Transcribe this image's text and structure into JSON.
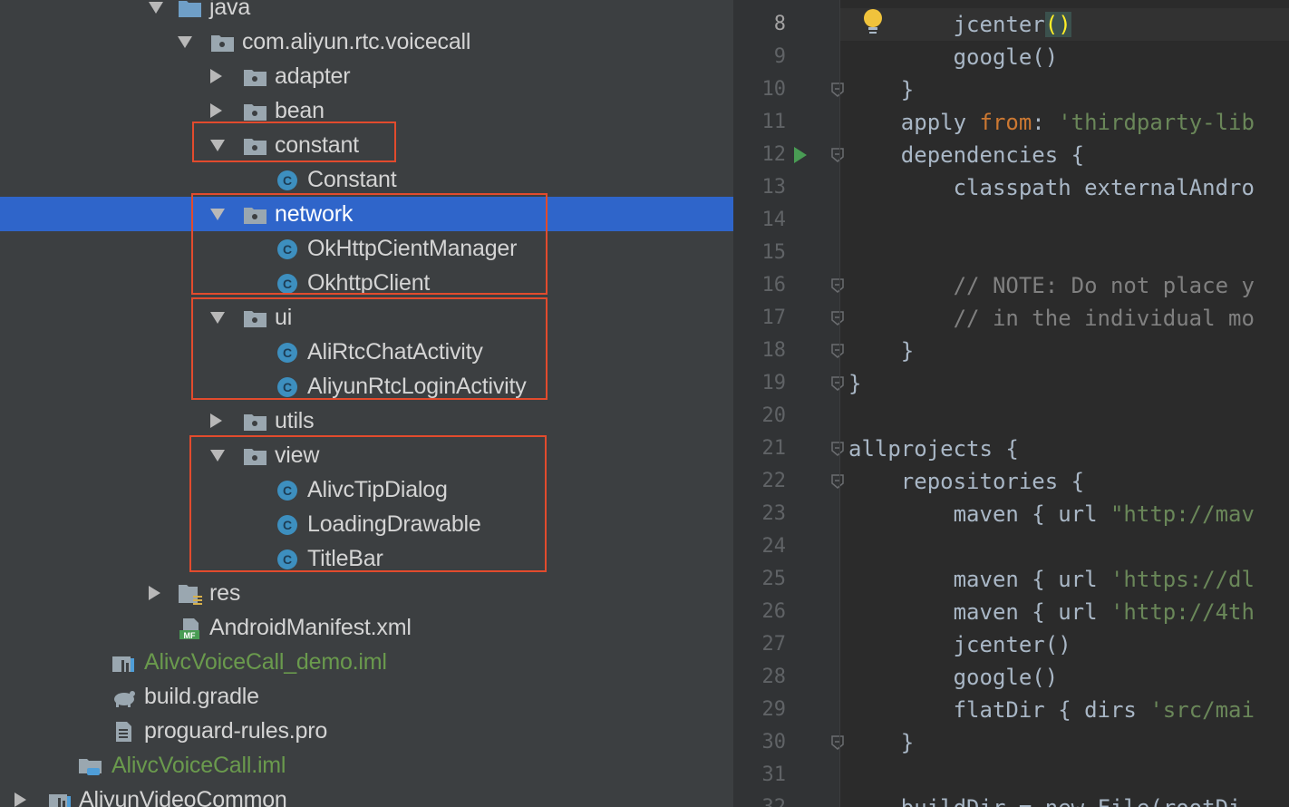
{
  "tree": {
    "rows": [
      {
        "label": "java",
        "indent": 2,
        "kind": "folder-blue",
        "arrow": "down"
      },
      {
        "label": "com.aliyun.rtc.voicecall",
        "indent": 3,
        "kind": "package",
        "arrow": "down"
      },
      {
        "label": "adapter",
        "indent": 4,
        "kind": "package",
        "arrow": "right"
      },
      {
        "label": "bean",
        "indent": 4,
        "kind": "package",
        "arrow": "right"
      },
      {
        "label": "constant",
        "indent": 4,
        "kind": "package",
        "arrow": "down"
      },
      {
        "label": "Constant",
        "indent": 5,
        "kind": "class",
        "arrow": "none"
      },
      {
        "label": "network",
        "indent": 4,
        "kind": "package",
        "arrow": "down",
        "selected": true
      },
      {
        "label": "OkHttpCientManager",
        "indent": 5,
        "kind": "class",
        "arrow": "none"
      },
      {
        "label": "OkhttpClient",
        "indent": 5,
        "kind": "class",
        "arrow": "none"
      },
      {
        "label": "ui",
        "indent": 4,
        "kind": "package",
        "arrow": "down"
      },
      {
        "label": "AliRtcChatActivity",
        "indent": 5,
        "kind": "class",
        "arrow": "none"
      },
      {
        "label": "AliyunRtcLoginActivity",
        "indent": 5,
        "kind": "class",
        "arrow": "none"
      },
      {
        "label": "utils",
        "indent": 4,
        "kind": "package",
        "arrow": "right"
      },
      {
        "label": "view",
        "indent": 4,
        "kind": "package",
        "arrow": "down"
      },
      {
        "label": "AlivcTipDialog",
        "indent": 5,
        "kind": "class",
        "arrow": "none"
      },
      {
        "label": "LoadingDrawable",
        "indent": 5,
        "kind": "class",
        "arrow": "none"
      },
      {
        "label": "TitleBar",
        "indent": 5,
        "kind": "class",
        "arrow": "none"
      },
      {
        "label": "res",
        "indent": 2,
        "kind": "res-folder",
        "arrow": "right"
      },
      {
        "label": "AndroidManifest.xml",
        "indent": 2,
        "kind": "manifest",
        "arrow": "none"
      },
      {
        "label": "AlivcVoiceCall_demo.iml",
        "indent": 0,
        "kind": "iml",
        "arrow": "none",
        "green": true
      },
      {
        "label": "build.gradle",
        "indent": 0,
        "kind": "gradle",
        "arrow": "none"
      },
      {
        "label": "proguard-rules.pro",
        "indent": 0,
        "kind": "file",
        "arrow": "none"
      },
      {
        "label": "AlivcVoiceCall.iml",
        "indent": -1,
        "kind": "module-iml",
        "arrow": "none",
        "green": true
      },
      {
        "label": "AliyunVideoCommon",
        "indent": -2,
        "kind": "module",
        "arrow": "right"
      }
    ]
  },
  "editor": {
    "current_line": 8,
    "lines": [
      {
        "n": "8",
        "tokens": [
          {
            "t": "        jcenter",
            "c": "fn"
          },
          {
            "t": "()",
            "c": "fn"
          }
        ],
        "bulb": true
      },
      {
        "n": "9",
        "tokens": [
          {
            "t": "        google()",
            "c": "fn"
          }
        ]
      },
      {
        "n": "10",
        "tokens": [
          {
            "t": "    }",
            "c": "fn"
          }
        ],
        "fold": true
      },
      {
        "n": "11",
        "tokens": [
          {
            "t": "    apply ",
            "c": "fn"
          },
          {
            "t": "from",
            "c": "kw"
          },
          {
            "t": ": ",
            "c": "fn"
          },
          {
            "t": "'thirdparty-lib",
            "c": "str"
          }
        ]
      },
      {
        "n": "12",
        "tokens": [
          {
            "t": "    dependencies {",
            "c": "fn"
          }
        ],
        "fold": true,
        "run": true
      },
      {
        "n": "13",
        "tokens": [
          {
            "t": "        classpath externalAndro",
            "c": "fn"
          }
        ]
      },
      {
        "n": "14",
        "tokens": []
      },
      {
        "n": "15",
        "tokens": []
      },
      {
        "n": "16",
        "tokens": [
          {
            "t": "        // NOTE: Do not place y",
            "c": "cm"
          }
        ],
        "fold": true
      },
      {
        "n": "17",
        "tokens": [
          {
            "t": "        // in the individual mo",
            "c": "cm"
          }
        ],
        "fold": true
      },
      {
        "n": "18",
        "tokens": [
          {
            "t": "    }",
            "c": "fn"
          }
        ],
        "fold": true
      },
      {
        "n": "19",
        "tokens": [
          {
            "t": "}",
            "c": "fn"
          }
        ],
        "fold": true
      },
      {
        "n": "20",
        "tokens": []
      },
      {
        "n": "21",
        "tokens": [
          {
            "t": "allprojects {",
            "c": "fn"
          }
        ],
        "fold": true
      },
      {
        "n": "22",
        "tokens": [
          {
            "t": "    repositories {",
            "c": "fn"
          }
        ],
        "fold": true
      },
      {
        "n": "23",
        "tokens": [
          {
            "t": "        maven { url ",
            "c": "fn"
          },
          {
            "t": "\"http://mav",
            "c": "str"
          }
        ]
      },
      {
        "n": "24",
        "tokens": []
      },
      {
        "n": "25",
        "tokens": [
          {
            "t": "        maven { url ",
            "c": "fn"
          },
          {
            "t": "'https://dl",
            "c": "str"
          }
        ]
      },
      {
        "n": "26",
        "tokens": [
          {
            "t": "        maven { url ",
            "c": "fn"
          },
          {
            "t": "'http://4th",
            "c": "str"
          }
        ]
      },
      {
        "n": "27",
        "tokens": [
          {
            "t": "        jcenter()",
            "c": "fn"
          }
        ]
      },
      {
        "n": "28",
        "tokens": [
          {
            "t": "        google()",
            "c": "fn"
          }
        ]
      },
      {
        "n": "29",
        "tokens": [
          {
            "t": "        flatDir { dirs ",
            "c": "fn"
          },
          {
            "t": "'src/mai",
            "c": "str"
          }
        ]
      },
      {
        "n": "30",
        "tokens": [
          {
            "t": "    }",
            "c": "fn"
          }
        ],
        "fold": true
      },
      {
        "n": "31",
        "tokens": []
      },
      {
        "n": "32",
        "tokens": [
          {
            "t": "    buildDir = new File(rootDi",
            "c": "fn"
          }
        ]
      }
    ]
  },
  "colors": {
    "selection": "#2f65ca",
    "annotation_box": "#e24b2d",
    "package_icon": "#9aa7b0",
    "class_icon": "#3d8fbf",
    "green_file": "#6a9a4d"
  }
}
